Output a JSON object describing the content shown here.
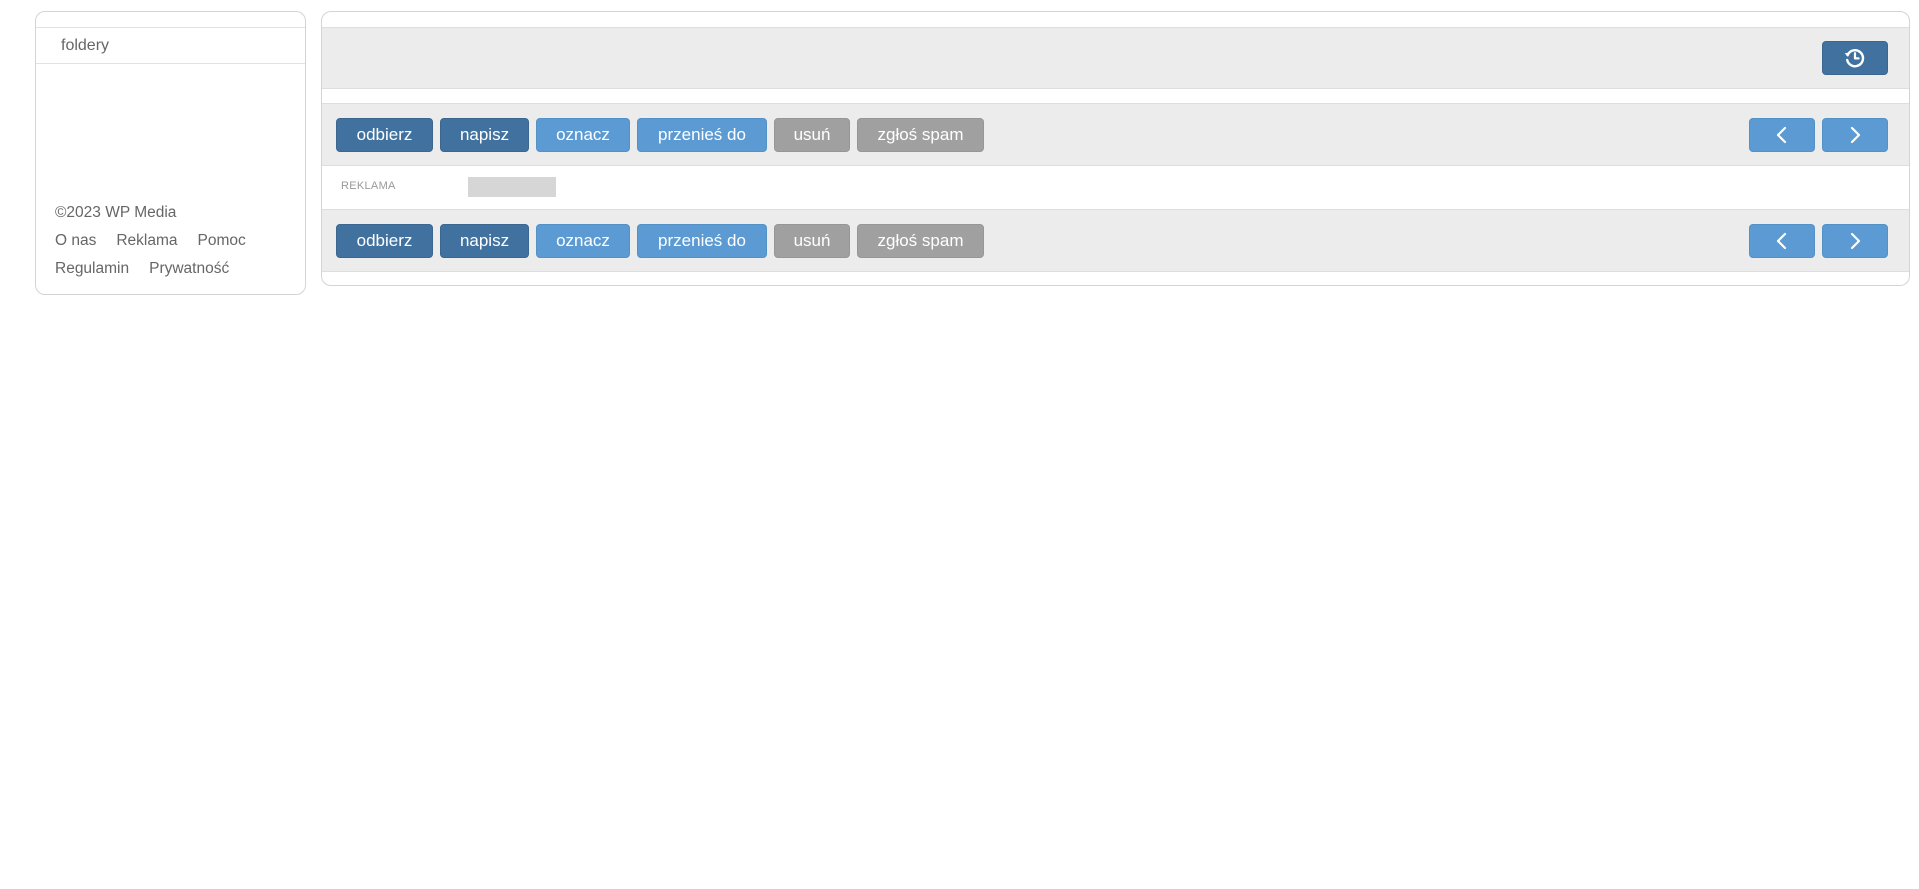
{
  "sidebar": {
    "folders_label": "foldery",
    "copyright": "©2023 WP Media",
    "links_row1": [
      "O nas",
      "Reklama",
      "Pomoc"
    ],
    "links_row2": [
      "Regulamin",
      "Prywatność"
    ]
  },
  "topbar": {
    "history_icon": "history-icon"
  },
  "toolbar": {
    "receive": "odbierz",
    "compose": "napisz",
    "mark": "oznacz",
    "move_to": "przenieś do",
    "delete": "usuń",
    "report_spam": "zgłoś spam",
    "prev_icon": "chevron-left-icon",
    "next_icon": "chevron-right-icon"
  },
  "ad": {
    "label": "REKLAMA"
  },
  "colors": {
    "primary_dark": "#41729f",
    "primary_light": "#5b9ad2",
    "neutral": "#a0a0a0",
    "bar_background": "#ececec"
  }
}
